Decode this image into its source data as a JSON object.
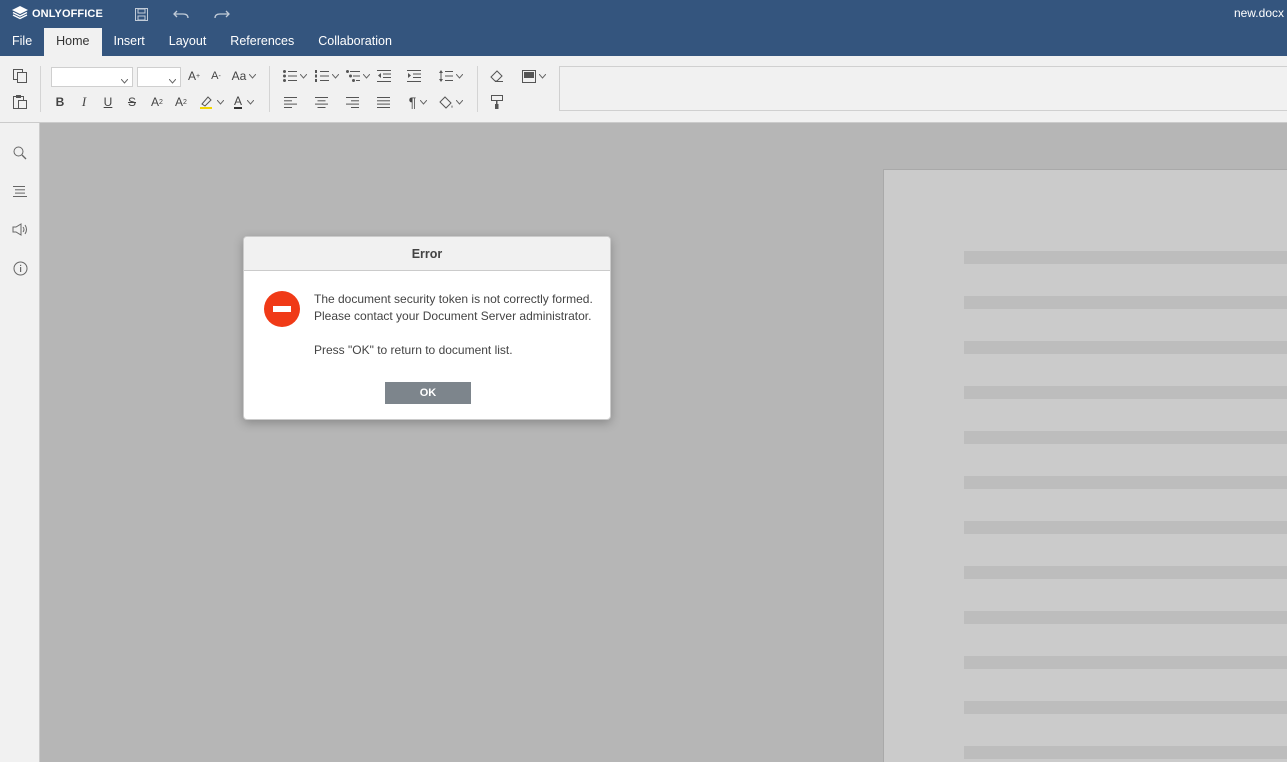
{
  "header": {
    "brand": "ONLYOFFICE",
    "doc_title": "new.docx",
    "quick_actions": [
      "save-icon",
      "undo-icon",
      "redo-icon"
    ],
    "colors": {
      "bar": "#34557e",
      "toolbar": "#f1f1f1"
    }
  },
  "tabs": [
    {
      "label": "File",
      "active": false
    },
    {
      "label": "Home",
      "active": true
    },
    {
      "label": "Insert",
      "active": false
    },
    {
      "label": "Layout",
      "active": false
    },
    {
      "label": "References",
      "active": false
    },
    {
      "label": "Collaboration",
      "active": false
    }
  ],
  "toolbar": {
    "icons": [
      "copy-icon",
      "paste-icon",
      "font-name-combo",
      "font-size-combo",
      "increase-font-icon",
      "decrease-font-icon",
      "change-case-icon",
      "bold-icon",
      "italic-icon",
      "underline-icon",
      "strikethrough-icon",
      "superscript-icon",
      "subscript-icon",
      "highlight-icon",
      "font-color-icon",
      "bullets-icon",
      "numbering-icon",
      "multilevel-icon",
      "decrease-indent-icon",
      "increase-indent-icon",
      "line-spacing-icon",
      "align-left-icon",
      "align-center-icon",
      "align-right-icon",
      "justify-icon",
      "paragraph-marks-icon",
      "shading-icon",
      "clear-style-icon",
      "columns-icon",
      "copy-style-icon"
    ]
  },
  "leftpanel": {
    "icons": [
      "search-icon",
      "navigation-icon",
      "feedback-icon",
      "about-icon"
    ]
  },
  "dialog": {
    "title": "Error",
    "line1": "The document security token is not correctly formed.",
    "line2": "Please contact your Document Server administrator.",
    "line3": "Press \"OK\" to return to document list.",
    "ok_label": "OK",
    "colors": {
      "icon": "#f03a17",
      "button": "#7d858c"
    }
  }
}
